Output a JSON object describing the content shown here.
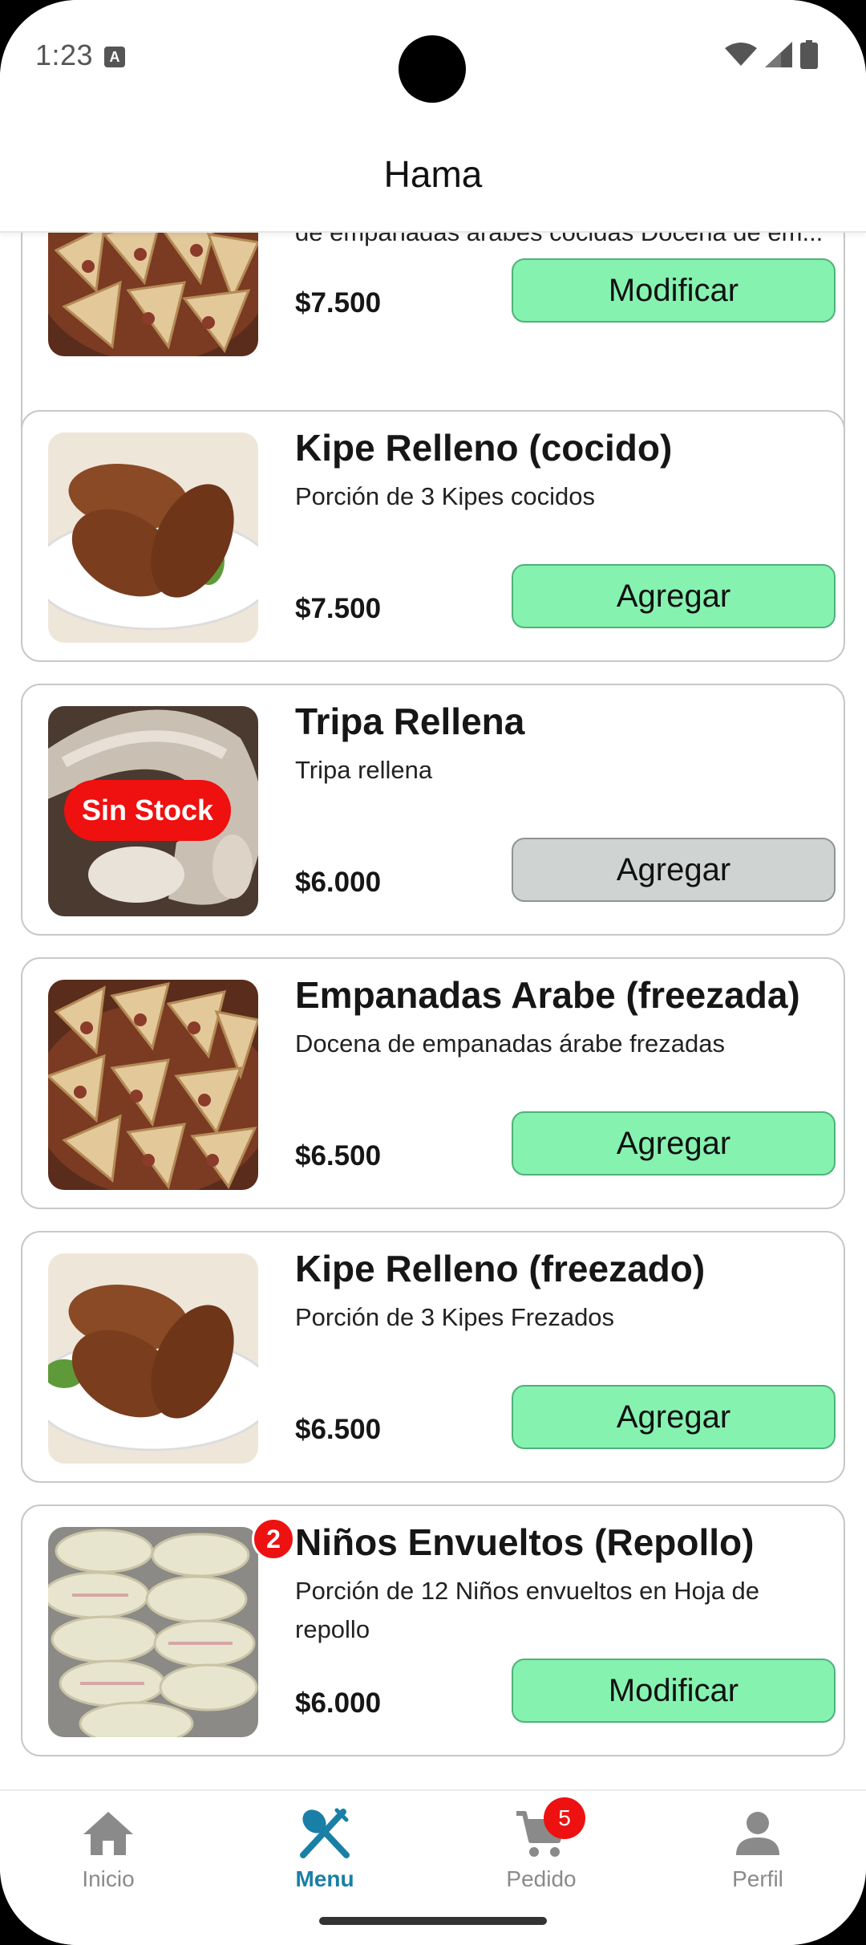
{
  "status_bar": {
    "time": "1:23",
    "notification_icon": "A"
  },
  "app_bar": {
    "title": "Hama"
  },
  "products": [
    {
      "id": "p0",
      "title": "",
      "description": "de empanadas árabes cocidas Docena de em...",
      "price": "$7.500",
      "button_label": "Modificar",
      "button_state": "enabled",
      "image": "empanadas",
      "partial": true
    },
    {
      "id": "p1",
      "title": "Kipe Relleno (cocido)",
      "description": "Porción de 3 Kipes cocidos",
      "price": "$7.500",
      "button_label": "Agregar",
      "button_state": "enabled",
      "image": "kipe"
    },
    {
      "id": "p2",
      "title": "Tripa Rellena",
      "description": "Tripa rellena",
      "price": "$6.000",
      "button_label": "Agregar",
      "button_state": "disabled",
      "badge": "Sin Stock",
      "image": "tripa"
    },
    {
      "id": "p3",
      "title": "Empanadas Arabe (freezada)",
      "description": "Docena de empanadas árabe frezadas",
      "price": "$6.500",
      "button_label": "Agregar",
      "button_state": "enabled",
      "image": "empanadas"
    },
    {
      "id": "p4",
      "title": "Kipe Relleno (freezado)",
      "description": "Porción de 3 Kipes Frezados",
      "price": "$6.500",
      "button_label": "Agregar",
      "button_state": "enabled",
      "image": "kipe"
    },
    {
      "id": "p5",
      "title": "Niños Envueltos (Repollo)",
      "description": "Porción de 12 Niños envueltos en Hoja de repollo",
      "price": "$6.000",
      "button_label": "Modificar",
      "button_state": "enabled",
      "quantity_badge": "2",
      "image": "repollo"
    }
  ],
  "bottom_nav": {
    "items": [
      {
        "label": "Inicio",
        "icon": "home-icon",
        "active": false
      },
      {
        "label": "Menu",
        "icon": "utensils-icon",
        "active": true
      },
      {
        "label": "Pedido",
        "icon": "cart-icon",
        "active": false,
        "badge": "5"
      },
      {
        "label": "Perfil",
        "icon": "person-icon",
        "active": false
      }
    ]
  },
  "colors": {
    "button_green": "#86f2b0",
    "button_disabled": "#cfd3d1",
    "badge_red": "#ee1111",
    "active_nav": "#1a7fa6",
    "inactive_nav": "#8a8a8a"
  }
}
